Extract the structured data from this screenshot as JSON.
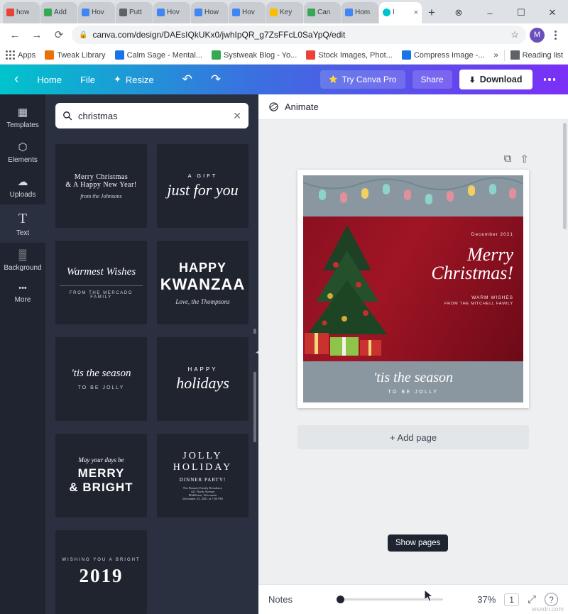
{
  "browser": {
    "tabs": [
      {
        "label": "how",
        "favicon": "#ea4335",
        "active": false
      },
      {
        "label": "Add",
        "favicon": "#34a853",
        "active": false
      },
      {
        "label": "Hov",
        "favicon": "#4285f4",
        "active": false
      },
      {
        "label": "Putt",
        "favicon": "#5f6368",
        "active": false
      },
      {
        "label": "Hov",
        "favicon": "#4285f4",
        "active": false
      },
      {
        "label": "How",
        "favicon": "#4285f4",
        "active": false
      },
      {
        "label": "Hov",
        "favicon": "#4285f4",
        "active": false
      },
      {
        "label": "Key",
        "favicon": "#fbbc04",
        "active": false
      },
      {
        "label": "Can",
        "favicon": "#34a853",
        "active": false
      },
      {
        "label": "Hom",
        "favicon": "#4285f4",
        "active": false
      },
      {
        "label": "I",
        "favicon": "#00c4cc",
        "active": true
      }
    ],
    "new_tab_label": "+",
    "window_controls": {
      "minimize": "–",
      "maximize": "☐",
      "close": "✕"
    },
    "record_dot": "⊗",
    "nav": {
      "back": "←",
      "forward": "→",
      "reload": "⟳"
    },
    "omnibox": {
      "lock_icon": "lock-icon",
      "url": "canva.com/design/DAEsIQkUKx0/jwhIpQR_g7ZsFFcL0SaYpQ/edit",
      "star_icon": "☆"
    },
    "profile_initial": "M",
    "bookmarks": [
      {
        "label": "Apps",
        "color": "apps"
      },
      {
        "label": "Tweak Library",
        "color": "#e8710a"
      },
      {
        "label": "Calm Sage - Mental...",
        "color": "#1a73e8"
      },
      {
        "label": "Systweak Blog - Yo...",
        "color": "#34a853"
      },
      {
        "label": "Stock Images, Phot...",
        "color": "#ea4335"
      },
      {
        "label": "Compress Image -...",
        "color": "#1a73e8"
      }
    ],
    "bookmarks_overflow": "»",
    "reading_list": "Reading list"
  },
  "canva": {
    "header": {
      "back_icon": "‹",
      "home": "Home",
      "file": "File",
      "resize_icon": "✦",
      "resize": "Resize",
      "undo_icon": "↶",
      "redo_icon": "↷",
      "try_pro_icon": "⭐",
      "try_pro": "Try Canva Pro",
      "share": "Share",
      "download_icon": "⬇",
      "download": "Download",
      "more_icon": "more-dots"
    },
    "rail": [
      {
        "label": "Templates",
        "icon": "▦",
        "active": false
      },
      {
        "label": "Elements",
        "icon": "⬡",
        "active": false
      },
      {
        "label": "Uploads",
        "icon": "☁",
        "active": false
      },
      {
        "label": "Text",
        "icon": "T",
        "active": true
      },
      {
        "label": "Background",
        "icon": "▒",
        "active": false
      },
      {
        "label": "More",
        "icon": "•••",
        "active": false
      }
    ],
    "panel": {
      "search_icon": "search-icon",
      "search_value": "christmas",
      "clear_icon": "✕",
      "results": [
        {
          "lines": [
            "Merry Christmas",
            "& A Happy New Year!",
            "from the Johnsons"
          ],
          "style": "script-small"
        },
        {
          "lines": [
            "A GIFT",
            "just for you"
          ],
          "style": "script-big"
        },
        {
          "lines": [
            "Warmest Wishes",
            "FROM THE MERCADO FAMILY"
          ],
          "style": "script-small"
        },
        {
          "lines": [
            "HAPPY",
            "KWANZAA",
            "Love, the Thompsons"
          ],
          "style": "bold-serif"
        },
        {
          "lines": [
            "'tis the season",
            "TO BE JOLLY"
          ],
          "style": "script-small"
        },
        {
          "lines": [
            "HAPPY",
            "holidays"
          ],
          "style": "script-big"
        },
        {
          "lines": [
            "May your days be",
            "MERRY",
            "& BRIGHT"
          ],
          "style": "bold-serif"
        },
        {
          "lines": [
            "JOLLY",
            "HOLIDAY",
            "DINNER PARTY!",
            "The Bennett Family Residence",
            "421 North Avenue",
            "Middleton, Wisconsin",
            "December 23, 2021 at 7:00 PM"
          ],
          "style": "serif-stack"
        },
        {
          "lines": [
            "WISHING YOU A BRIGHT",
            "2019"
          ],
          "style": "bold-serif"
        }
      ]
    },
    "editor": {
      "animate_icon": "animate-icon",
      "animate_label": "Animate",
      "page_tools": {
        "duplicate_icon": "⧉",
        "share_icon": "⇧"
      },
      "design": {
        "date": "December 2021",
        "greeting_line1": "Merry",
        "greeting_line2": "Christmas!",
        "warm_line1": "WARM WISHES",
        "warm_line2": "FROM THE MITCHELL FAMILY",
        "caption_line1": "'tis the season",
        "caption_line2": "TO BE JOLLY"
      },
      "add_page": "+ Add page",
      "tooltip": "Show pages",
      "bottom": {
        "notes": "Notes",
        "zoom": "37%",
        "page_count": "1",
        "fullscreen_icon": "⤢",
        "help_icon": "?"
      }
    }
  },
  "watermark": "wsxdn.com"
}
